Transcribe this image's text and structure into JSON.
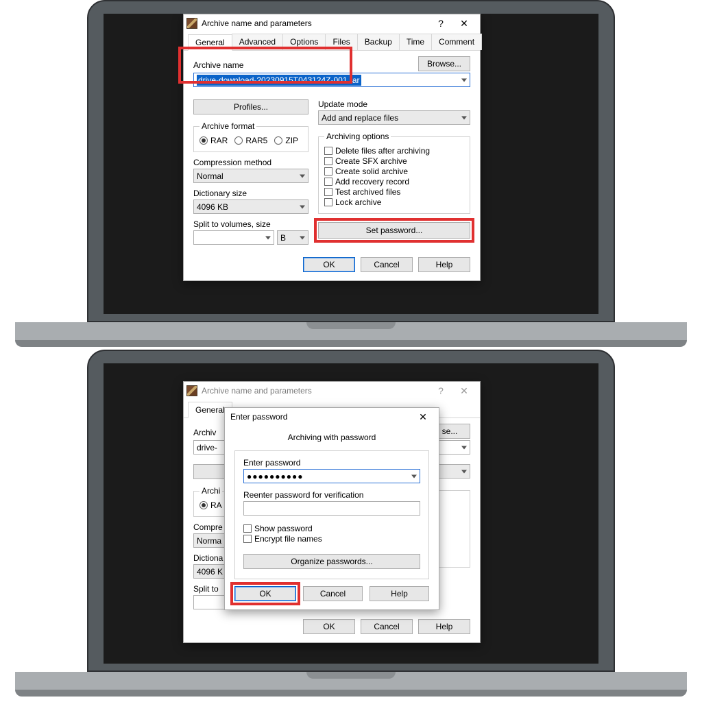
{
  "dialog1": {
    "title": "Archive name and parameters",
    "tabs": [
      "General",
      "Advanced",
      "Options",
      "Files",
      "Backup",
      "Time",
      "Comment"
    ],
    "active_tab": 0,
    "browse_label": "Browse...",
    "archive_name_label": "Archive name",
    "archive_name_value": "drive-download-20230915T043124Z-001.rar",
    "profiles_label": "Profiles...",
    "update_mode_label": "Update mode",
    "update_mode_value": "Add and replace files",
    "archive_format_label": "Archive format",
    "formats": [
      "RAR",
      "RAR5",
      "ZIP"
    ],
    "format_selected": 0,
    "compression_label": "Compression method",
    "compression_value": "Normal",
    "dictionary_label": "Dictionary size",
    "dictionary_value": "4096 KB",
    "split_label": "Split to volumes, size",
    "split_value": "",
    "split_unit": "B",
    "arch_options_label": "Archiving options",
    "arch_options": [
      "Delete files after archiving",
      "Create SFX archive",
      "Create solid archive",
      "Add recovery record",
      "Test archived files",
      "Lock archive"
    ],
    "set_password_label": "Set password...",
    "ok": "OK",
    "cancel": "Cancel",
    "help": "Help"
  },
  "dialog2_bg": {
    "title": "Archive name and parameters",
    "tab_general": "General",
    "archive_label_short": "Archiv",
    "archive_value_short": "drive-",
    "browse_label_short": "se...",
    "archive_format_short": "Archi",
    "rar_short": "RA",
    "compression_short": "Compre",
    "normal_short": "Norma",
    "dict_label_short": "Dictiona",
    "dict_value_short": "4096 K",
    "split_short": "Split to",
    "ok": "OK",
    "cancel": "Cancel",
    "help": "Help"
  },
  "password_dialog": {
    "title": "Enter password",
    "heading": "Archiving with password",
    "enter_label": "Enter password",
    "password_masked": "●●●●●●●●●●",
    "reenter_label": "Reenter password for verification",
    "reenter_value": "",
    "show_pw": "Show password",
    "encrypt_fn": "Encrypt file names",
    "organize": "Organize passwords...",
    "ok": "OK",
    "cancel": "Cancel",
    "help": "Help"
  },
  "colors": {
    "callout": "#e03030",
    "accent": "#0a63c9"
  }
}
